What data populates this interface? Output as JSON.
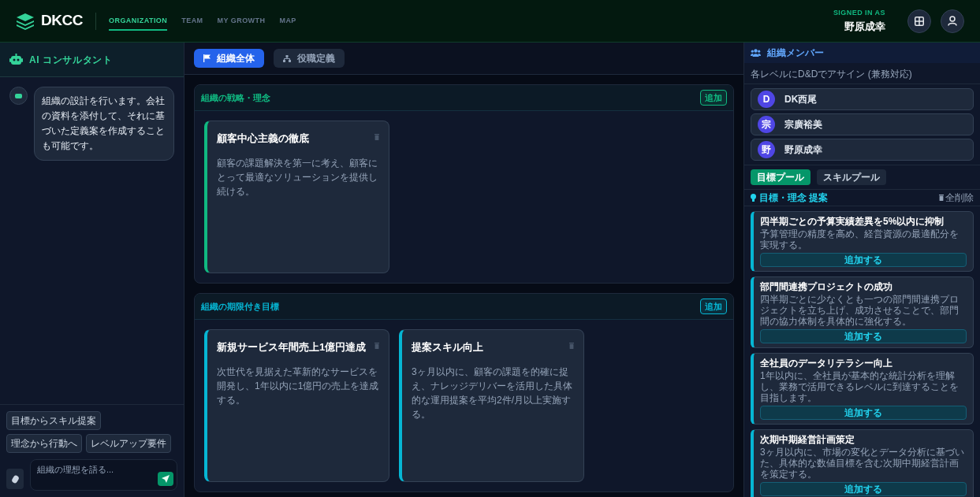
{
  "header": {
    "logo": "DKCC",
    "nav": [
      {
        "label": "ORGANIZATION",
        "selected": true
      },
      {
        "label": "TEAM",
        "selected": false
      },
      {
        "label": "MY GROWTH",
        "selected": false
      },
      {
        "label": "MAP",
        "selected": false
      }
    ],
    "signed_in_label": "SIGNED IN AS",
    "user_name": "野原成幸"
  },
  "assistant": {
    "title": "AI コンサルタント",
    "messages": [
      "組織の設計を行います。会社の資料を添付して、それに基づいた定義案を作成することも可能です。"
    ],
    "suggestions": [
      "目標からスキル提案",
      "理念から行動へ",
      "レベルアップ要件"
    ],
    "input": {
      "placeholder": "組織の理想を語る..."
    }
  },
  "view_tabs": [
    {
      "label": "組織全体",
      "kind": "flag",
      "selected": true
    },
    {
      "label": "役職定義",
      "kind": "hierarchy",
      "selected": false
    }
  ],
  "sections": [
    {
      "title": "組織の戦略・理念",
      "color": "#10b981",
      "add_button": "追加",
      "cards": [
        {
          "title": "顧客中心主義の徹底",
          "description": "顧客の課題解決を第一に考え、顧客にとって最適なソリューションを提供し続ける。"
        }
      ]
    },
    {
      "title": "組織の期限付き目標",
      "color": "#06b6d4",
      "add_button": "追加",
      "cards": [
        {
          "title": "新規サービス年間売上1億円達成",
          "description": "次世代を見据えた革新的なサービスを開発し、1年以内に1億円の売上を達成する。"
        },
        {
          "title": "提案スキル向上",
          "description": "3ヶ月以内に、顧客の課題を的確に捉え、ナレッジデリバーを活用した具体的な運用提案を平均2件/月以上実施する。"
        }
      ]
    }
  ],
  "members": {
    "title": "組織メンバー",
    "hint": "各レベルにD&Dでアサイン (兼務対応)",
    "items": [
      {
        "initial": "D",
        "name": "DK西尾"
      },
      {
        "initial": "宗",
        "name": "宗廣裕美"
      },
      {
        "initial": "野",
        "name": "野原成幸"
      }
    ]
  },
  "pool_tabs": [
    {
      "label": "目標プール",
      "selected": true
    },
    {
      "label": "スキルプール",
      "selected": false
    }
  ],
  "pool": {
    "title": "目標・理念 提案",
    "clear_all": "全削除",
    "items": [
      {
        "title": "四半期ごとの予算実績差異を5%以内に抑制",
        "description": "予算管理の精度を高め、経営資源の最適配分を実現する。",
        "button": "追加する"
      },
      {
        "title": "部門間連携プロジェクトの成功",
        "description": "四半期ごとに少なくとも一つの部門間連携プロジェクトを立ち上げ、成功させることで、部門間の協力体制を具体的に強化する。",
        "button": "追加する"
      },
      {
        "title": "全社員のデータリテラシー向上",
        "description": "1年以内に、全社員が基本的な統計分析を理解し、業務で活用できるレベルに到達することを目指します。",
        "button": "追加する"
      },
      {
        "title": "次期中期経営計画策定",
        "description": "3ヶ月以内に、市場の変化とデータ分析に基づいた、具体的な数値目標を含む次期中期経営計画を策定する。",
        "button": "追加する"
      }
    ]
  }
}
